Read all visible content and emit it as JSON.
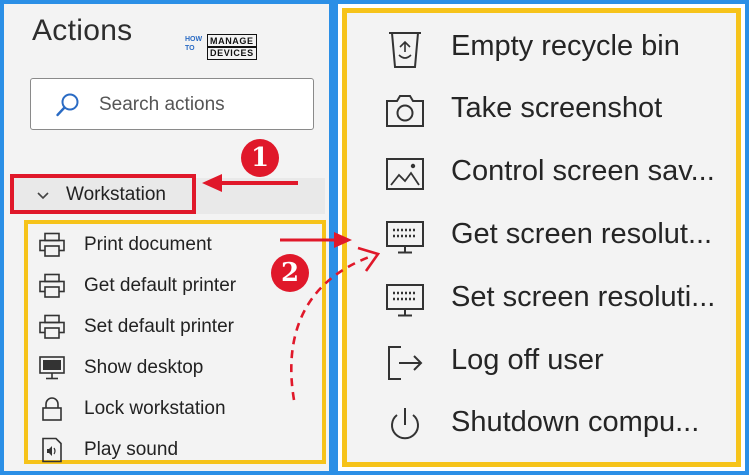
{
  "panel": {
    "title": "Actions",
    "logo": {
      "line1": "HOW",
      "line2": "TO",
      "line3": "MANAGE",
      "line4": "DEVICES"
    },
    "search": {
      "placeholder": "Search actions",
      "icon": "search-icon"
    },
    "group": {
      "label": "Workstation",
      "icon": "chevron-down-icon",
      "expanded": true
    }
  },
  "left_items": [
    {
      "label": "Print document",
      "icon": "printer-icon"
    },
    {
      "label": "Get default printer",
      "icon": "printer-icon"
    },
    {
      "label": "Set default printer",
      "icon": "printer-icon"
    },
    {
      "label": "Show desktop",
      "icon": "desktop-icon"
    },
    {
      "label": "Lock workstation",
      "icon": "lock-icon"
    },
    {
      "label": "Play sound",
      "icon": "sound-icon"
    }
  ],
  "right_items": [
    {
      "label": "Empty recycle bin",
      "icon": "recycle-bin-icon"
    },
    {
      "label": "Take screenshot",
      "icon": "camera-icon"
    },
    {
      "label": "Control screen sav...",
      "icon": "image-icon"
    },
    {
      "label": "Get screen resolut...",
      "icon": "monitor-icon"
    },
    {
      "label": "Set screen resoluti...",
      "icon": "monitor-icon"
    },
    {
      "label": "Log off user",
      "icon": "logoff-icon"
    },
    {
      "label": "Shutdown compu...",
      "icon": "power-icon"
    }
  ],
  "annotations": {
    "badge1": "1",
    "badge2": "2"
  },
  "colors": {
    "highlight_red": "#e0182a",
    "highlight_yellow": "#f6c31a",
    "frame_blue": "#2b8fe6"
  }
}
